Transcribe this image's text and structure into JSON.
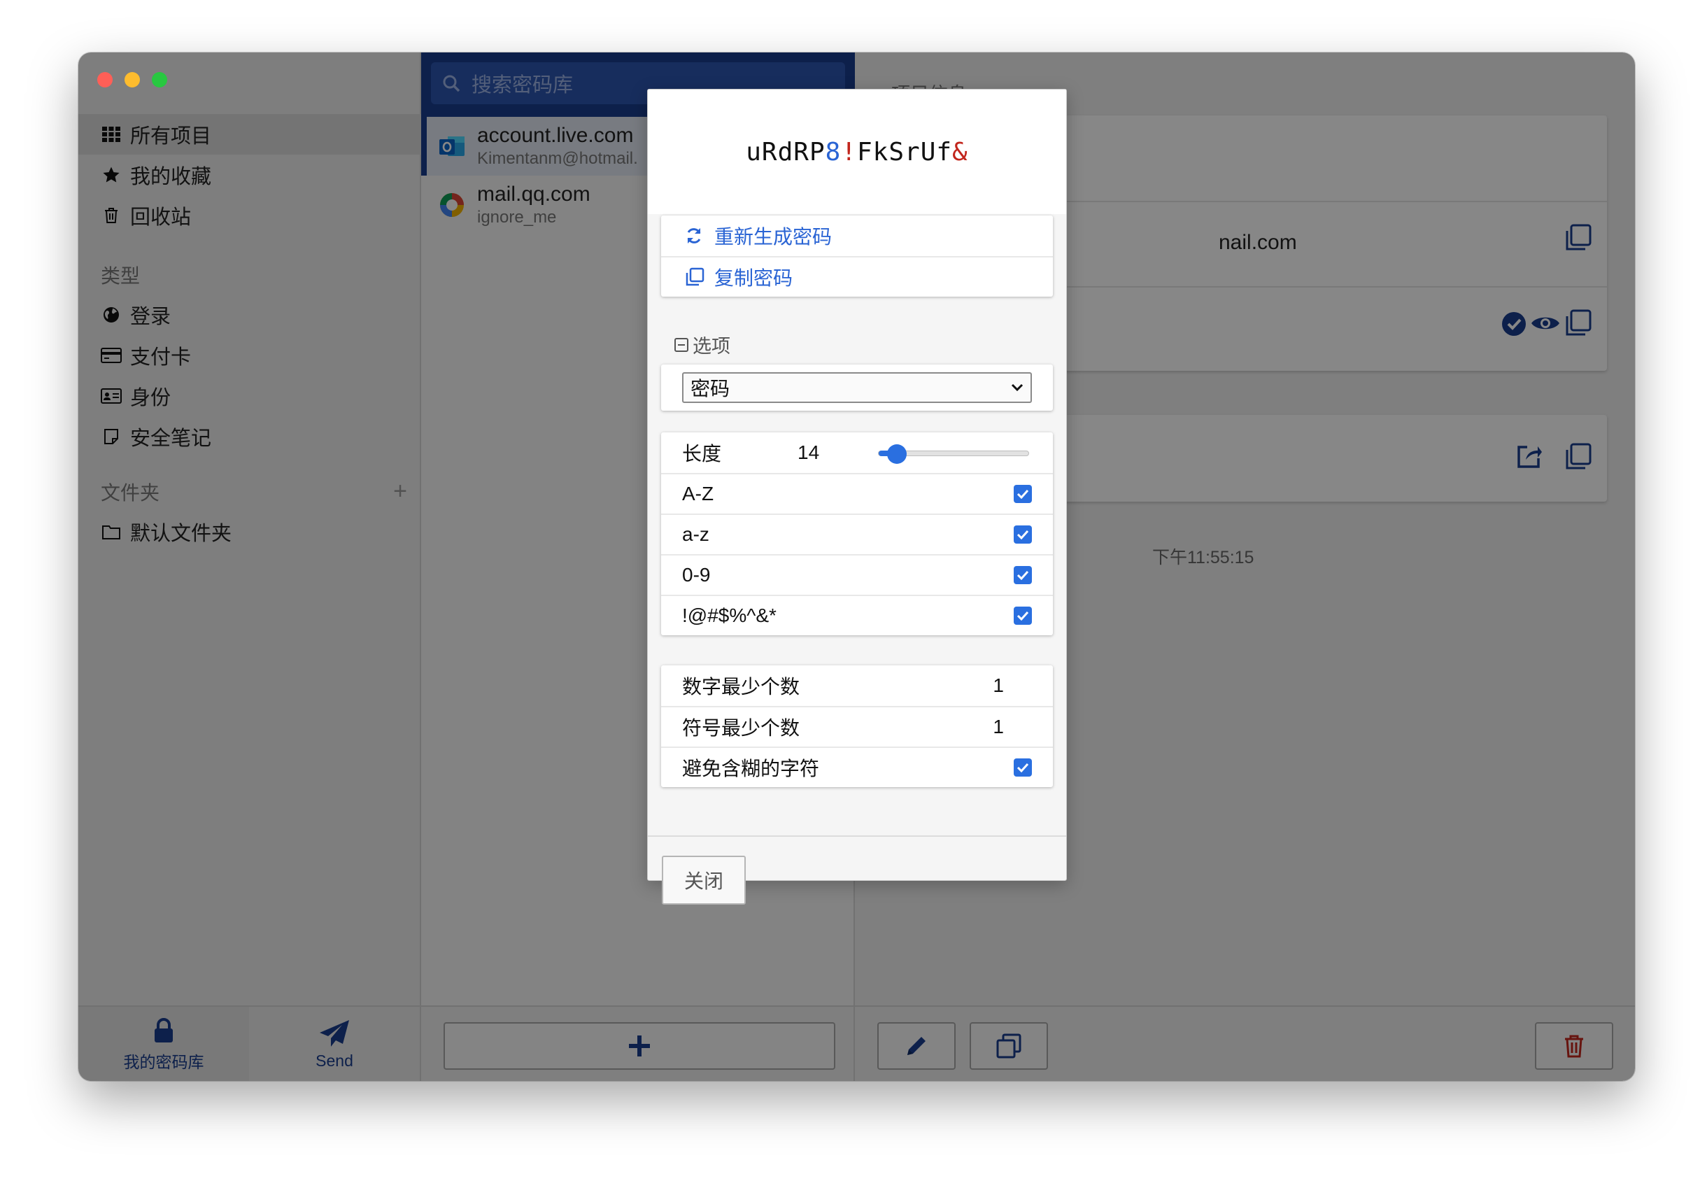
{
  "sidebar": {
    "items": [
      {
        "label": "所有项目",
        "icon": "grid-icon"
      },
      {
        "label": "我的收藏",
        "icon": "star-icon"
      },
      {
        "label": "回收站",
        "icon": "trash-icon"
      }
    ],
    "types_label": "类型",
    "types": [
      {
        "label": "登录",
        "icon": "globe-icon"
      },
      {
        "label": "支付卡",
        "icon": "credit-card-icon"
      },
      {
        "label": "身份",
        "icon": "id-card-icon"
      },
      {
        "label": "安全笔记",
        "icon": "note-icon"
      }
    ],
    "folders_label": "文件夹",
    "folders": [
      {
        "label": "默认文件夹",
        "icon": "folder-icon"
      }
    ],
    "add_folder": "+"
  },
  "bottom_tabs": {
    "vault": "我的密码库",
    "send": "Send"
  },
  "search": {
    "placeholder": "搜索密码库"
  },
  "list": [
    {
      "title": "account.live.com",
      "subtitle": "Kimentanm@hotmail.",
      "icon": "outlook-icon"
    },
    {
      "title": "mail.qq.com",
      "subtitle": "ignore_me",
      "icon": "qq-mail-icon"
    }
  ],
  "detail": {
    "header": "项目信息",
    "username_fragment": "nail.com",
    "updated_fragment": "下午11:55:15"
  },
  "generator": {
    "password_parts": [
      {
        "text": "uRdRP",
        "kind": "alpha"
      },
      {
        "text": "8",
        "kind": "num"
      },
      {
        "text": "!",
        "kind": "sym"
      },
      {
        "text": "FkSrUf",
        "kind": "alpha"
      },
      {
        "text": "&",
        "kind": "sym"
      }
    ],
    "regenerate_label": "重新生成密码",
    "copy_label": "复制密码",
    "options_label": "选项",
    "type_select": "密码",
    "length_label": "长度",
    "length_value": "14",
    "length_slider_fraction": 0.12,
    "uppercase_label": "A-Z",
    "lowercase_label": "a-z",
    "numbers_label": "0-9",
    "special_label": "!@#$%^&*",
    "min_numbers_label": "数字最少个数",
    "min_numbers_value": "1",
    "min_special_label": "符号最少个数",
    "min_special_value": "1",
    "avoid_ambiguous_label": "避免含糊的字符",
    "close_label": "关闭"
  },
  "colors": {
    "brand": "#1a3d8f",
    "accent": "#2a6fe0",
    "number": "#2a64d4",
    "symbol": "#c2261d",
    "danger": "#c2261d"
  }
}
